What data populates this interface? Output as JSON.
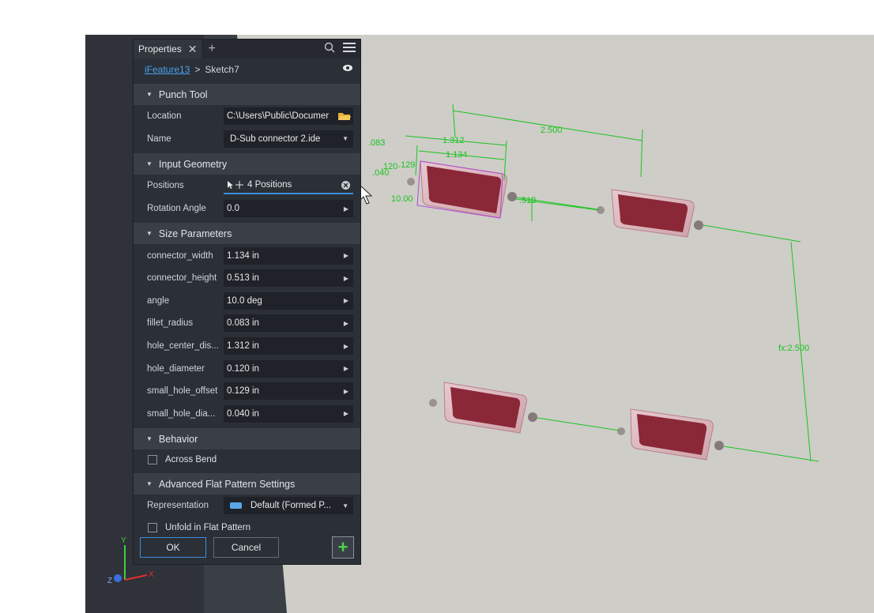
{
  "panel": {
    "tab_title": "Properties",
    "breadcrumb": {
      "parent": "iFeature13",
      "separator": ">",
      "current": "Sketch7"
    },
    "punch_tool": {
      "title": "Punch Tool",
      "location_label": "Location",
      "location_value": "C:\\Users\\Public\\Documer",
      "name_label": "Name",
      "name_value": "D-Sub connector 2.ide"
    },
    "input_geometry": {
      "title": "Input Geometry",
      "positions_label": "Positions",
      "positions_value": "4 Positions",
      "rotation_label": "Rotation Angle",
      "rotation_value": "0.0"
    },
    "size_parameters": {
      "title": "Size Parameters",
      "rows": [
        {
          "label": "connector_width",
          "value": "1.134 in"
        },
        {
          "label": "connector_height",
          "value": "0.513 in"
        },
        {
          "label": "angle",
          "value": "10.0 deg"
        },
        {
          "label": "fillet_radius",
          "value": "0.083 in"
        },
        {
          "label": "hole_center_dis...",
          "value": "1.312 in"
        },
        {
          "label": "hole_diameter",
          "value": "0.120 in"
        },
        {
          "label": "small_hole_offset",
          "value": "0.129 in"
        },
        {
          "label": "small_hole_dia...",
          "value": "0.040 in"
        }
      ]
    },
    "behavior": {
      "title": "Behavior",
      "across_bend_label": "Across Bend"
    },
    "advanced": {
      "title": "Advanced Flat Pattern Settings",
      "representation_label": "Representation",
      "representation_value": "Default (Formed P...",
      "unfold_label": "Unfold in Flat Pattern"
    },
    "buttons": {
      "ok": "OK",
      "cancel": "Cancel",
      "add": "+"
    }
  },
  "viewport": {
    "dimensions": {
      "d083": ".083",
      "d1312": "1.312",
      "d1134": "1.134",
      "d2500": "2.500",
      "d129": ".129",
      "d040": ".040",
      "d120": ".120",
      "d1000": "10.00",
      "d513": ".513",
      "fx2500": "fx:2.500"
    },
    "triad": {
      "y": "Y",
      "x": "X",
      "z": "Z"
    }
  },
  "colors": {
    "dimension": "#19c41f",
    "connector": "#8a2838",
    "panel": "#2b2f36",
    "accent": "#3d8ed8"
  }
}
